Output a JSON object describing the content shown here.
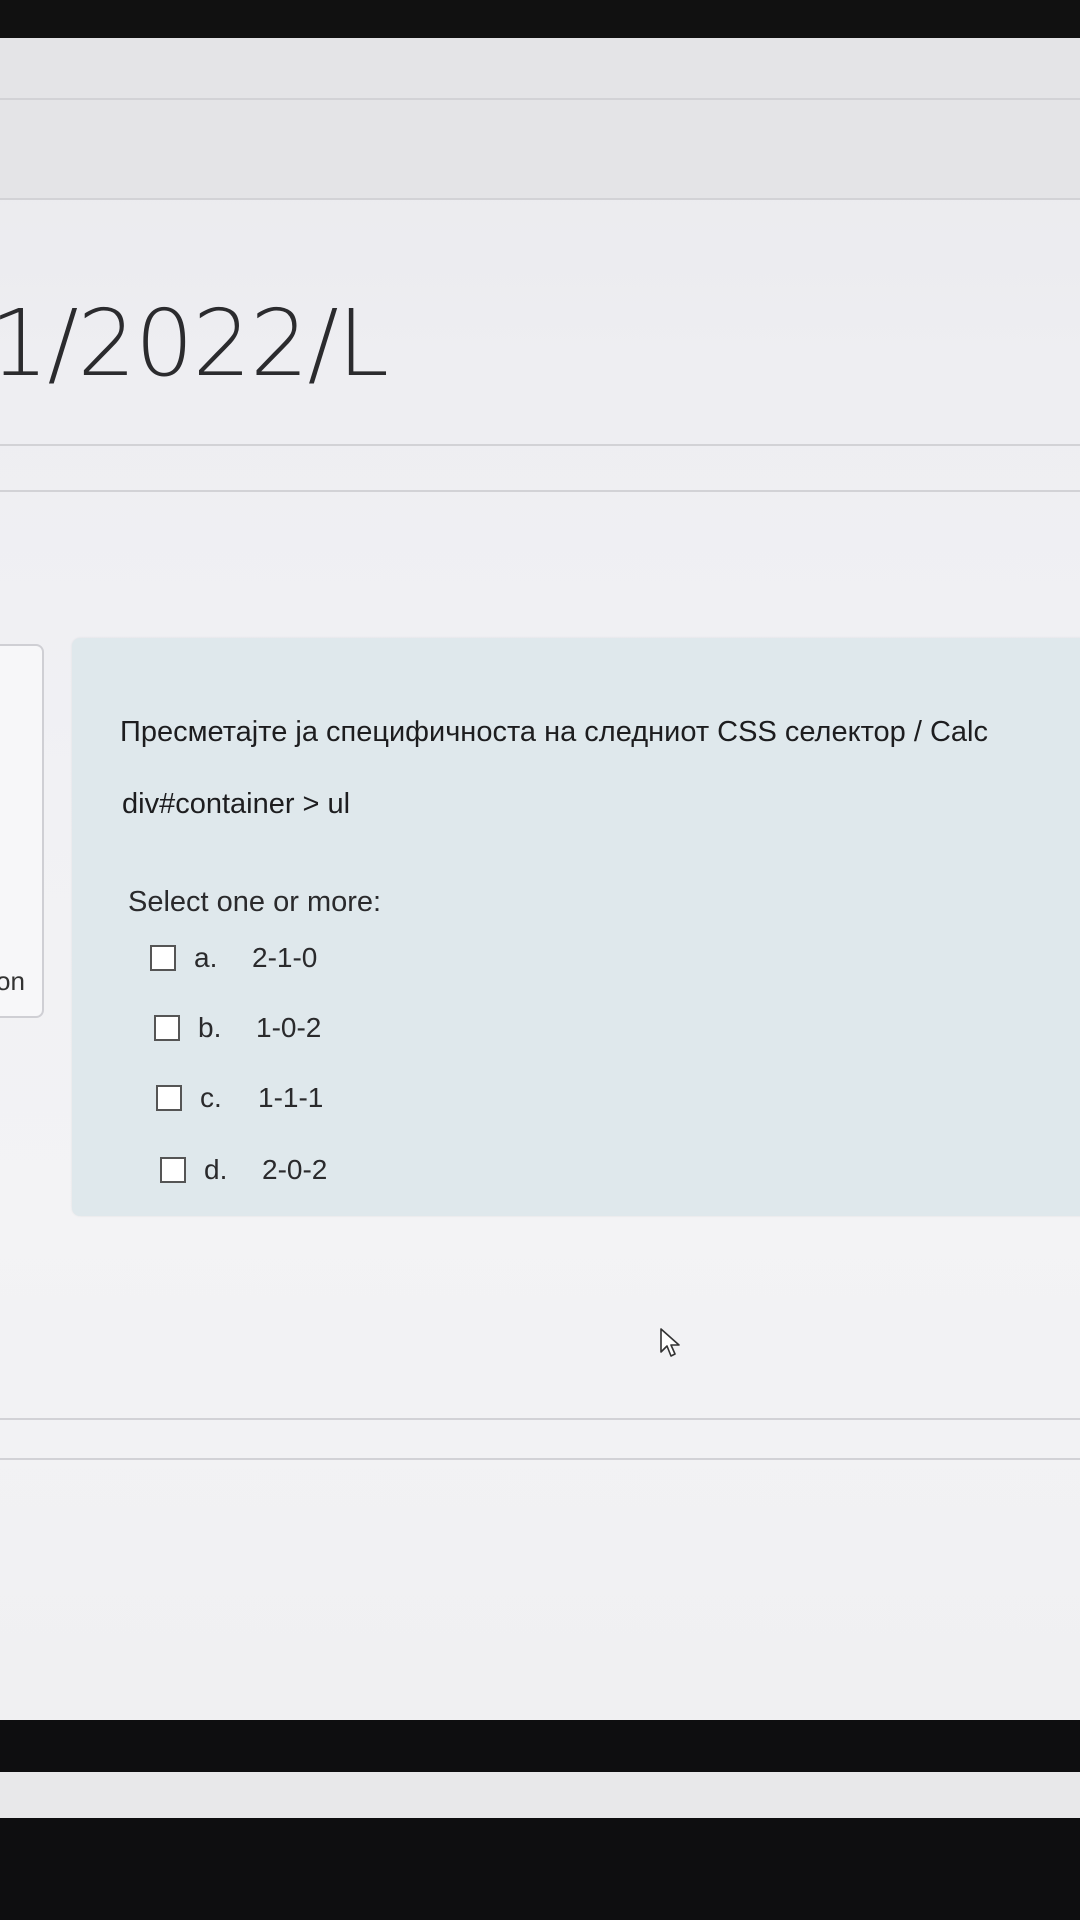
{
  "header": {
    "course_title": "1/2022/L"
  },
  "sidebar": {
    "label": "on"
  },
  "question": {
    "text": "Пресметајте ја специфичноста на следниот CSS селектор / Calc",
    "code": "div#container > ul",
    "prompt": "Select one or more:",
    "options": [
      {
        "letter": "a.",
        "value": "2-1-0"
      },
      {
        "letter": "b.",
        "value": "1-0-2"
      },
      {
        "letter": "c.",
        "value": "1-1-1"
      },
      {
        "letter": "d.",
        "value": "2-0-2"
      }
    ]
  },
  "icons": {
    "cursor": "mouse-pointer-icon"
  }
}
